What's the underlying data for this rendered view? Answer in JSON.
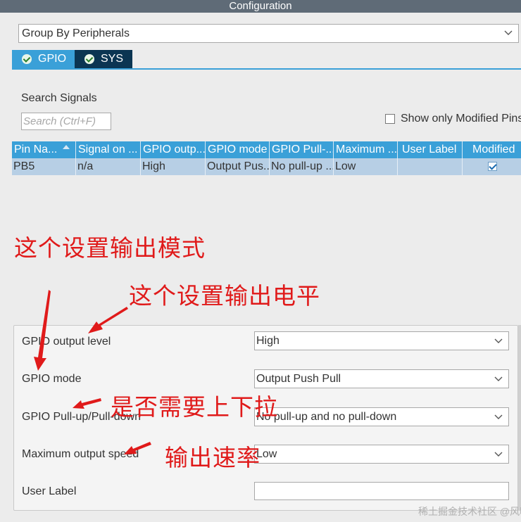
{
  "window": {
    "title": "Configuration"
  },
  "group_by": {
    "value": "Group By Peripherals"
  },
  "tabs": [
    {
      "label": "GPIO"
    },
    {
      "label": "SYS"
    }
  ],
  "search": {
    "label": "Search Signals",
    "placeholder": "Search (Ctrl+F)"
  },
  "show_modified": {
    "label": "Show only Modified Pins",
    "checked": false
  },
  "table": {
    "columns": [
      "Pin Na...",
      "Signal on ...",
      "GPIO outp...",
      "GPIO mode",
      "GPIO Pull-...",
      "Maximum ...",
      "User Label",
      "Modified"
    ],
    "rows": [
      {
        "pin": "PB5",
        "signal": "n/a",
        "output": "High",
        "mode": "Output Pus...",
        "pull": "No pull-up ...",
        "speed": "Low",
        "label": "",
        "modified": true
      }
    ]
  },
  "properties": {
    "output_level": {
      "label": "GPIO output level",
      "value": "High"
    },
    "mode": {
      "label": "GPIO mode",
      "value": "Output Push Pull"
    },
    "pull": {
      "label": "GPIO Pull-up/Pull-down",
      "value": "No pull-up and no pull-down"
    },
    "speed": {
      "label": "Maximum output speed",
      "value": "Low"
    },
    "user_label": {
      "label": "User Label",
      "value": ""
    }
  },
  "annotations": {
    "mode": "这个设置输出模式",
    "level": "这个设置输出电平",
    "pull": "是否需要上下拉",
    "speed": "输出速率"
  },
  "watermark": "稀土掘金技术社区 @风吹过"
}
